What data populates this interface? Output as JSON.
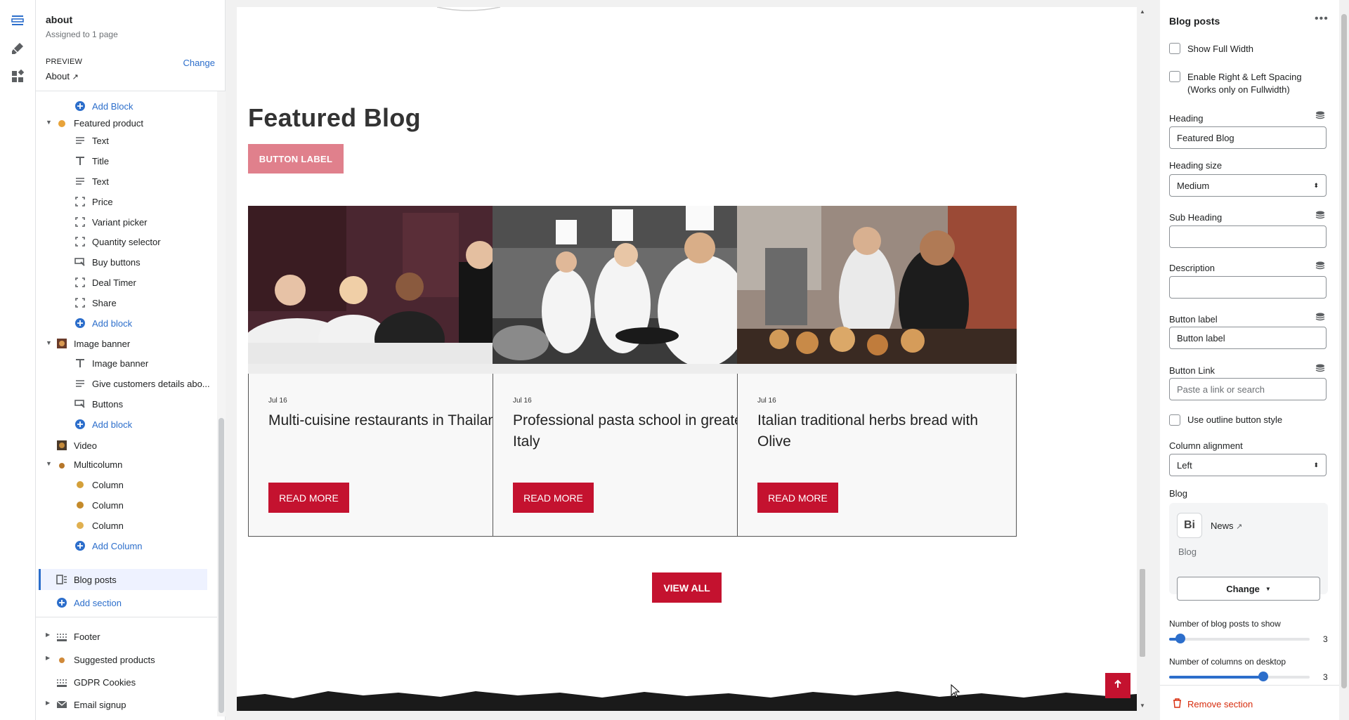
{
  "left": {
    "title": "about",
    "subtitle": "Assigned to 1 page",
    "preview_label": "PREVIEW",
    "change_label": "Change",
    "preview_page": "About",
    "items": [
      {
        "label": "Add Block"
      },
      {
        "label": "Featured product"
      },
      {
        "label": "Text"
      },
      {
        "label": "Title"
      },
      {
        "label": "Text"
      },
      {
        "label": "Price"
      },
      {
        "label": "Variant picker"
      },
      {
        "label": "Quantity selector"
      },
      {
        "label": "Buy buttons"
      },
      {
        "label": "Deal Timer"
      },
      {
        "label": "Share"
      },
      {
        "label": "Add block"
      },
      {
        "label": "Image banner"
      },
      {
        "label": "Image banner"
      },
      {
        "label": "Give customers details abo..."
      },
      {
        "label": "Buttons"
      },
      {
        "label": "Add block"
      },
      {
        "label": "Video"
      },
      {
        "label": "Multicolumn"
      },
      {
        "label": "Column"
      },
      {
        "label": "Column"
      },
      {
        "label": "Column"
      },
      {
        "label": "Add Column"
      },
      {
        "label": "Blog posts"
      },
      {
        "label": "Add section"
      }
    ],
    "footer_items": [
      {
        "label": "Footer"
      },
      {
        "label": "Suggested products"
      },
      {
        "label": "GDPR Cookies"
      },
      {
        "label": "Email signup"
      }
    ]
  },
  "preview": {
    "heading": "Featured Blog",
    "button_label": "BUTTON LABEL",
    "view_all": "VIEW ALL",
    "cards": [
      {
        "date": "Jul 16",
        "title": "Multi-cuisine restaurants in Thailand",
        "cta": "READ MORE"
      },
      {
        "date": "Jul 16",
        "title": "Professional pasta school in greater Italy",
        "cta": "READ MORE"
      },
      {
        "date": "Jul 16",
        "title": "Italian traditional herbs bread with Olive",
        "cta": "READ MORE"
      }
    ],
    "accent_color": "#c4122f"
  },
  "settings": {
    "section_title": "Blog posts",
    "show_full_width": "Show Full Width",
    "enable_spacing": "Enable Right & Left Spacing (Works only on Fullwidth)",
    "heading_label": "Heading",
    "heading_value": "Featured Blog",
    "heading_size_label": "Heading size",
    "heading_size_value": "Medium",
    "sub_heading_label": "Sub Heading",
    "sub_heading_value": "",
    "description_label": "Description",
    "description_value": "",
    "button_label_label": "Button label",
    "button_label_value": "Button label",
    "button_link_label": "Button Link",
    "button_link_placeholder": "Paste a link or search",
    "outline_label": "Use outline button style",
    "column_alignment_label": "Column alignment",
    "column_alignment_value": "Left",
    "blog_label": "Blog",
    "blog_name": "News",
    "blog_type": "Blog",
    "blog_change": "Change",
    "posts_to_show_label": "Number of blog posts to show",
    "posts_to_show_value": "3",
    "posts_to_show_fraction": 0.08,
    "columns_desktop_label": "Number of columns on desktop",
    "columns_desktop_value": "3",
    "columns_desktop_fraction": 0.67,
    "remove_section": "Remove section"
  }
}
